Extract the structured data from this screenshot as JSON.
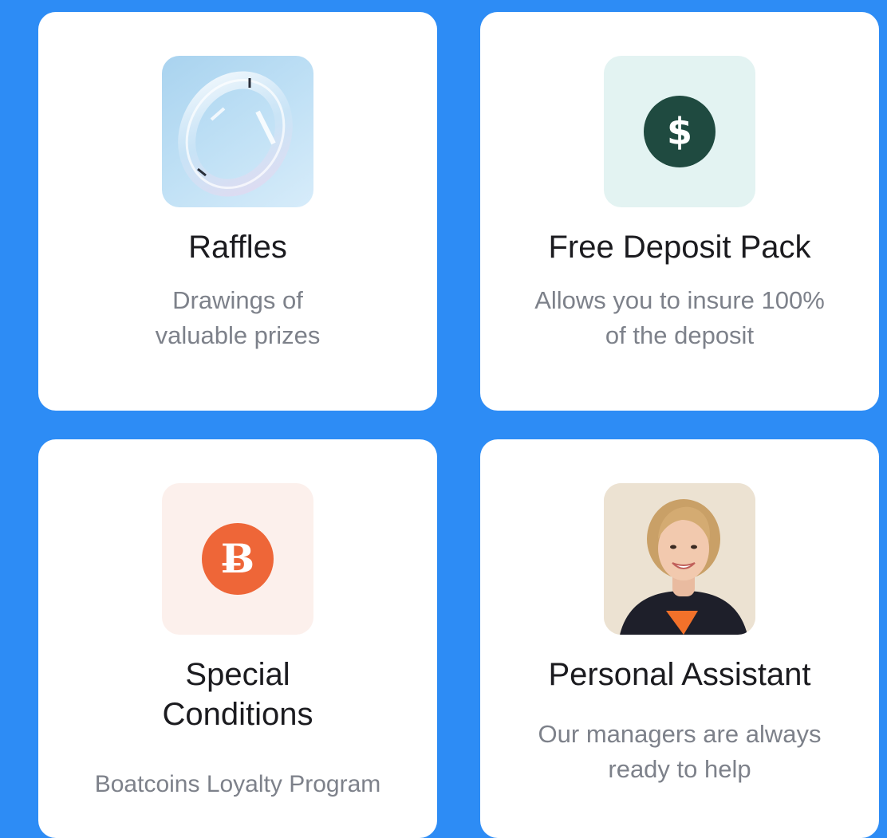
{
  "cards": [
    {
      "title": "Raffles",
      "desc_lines": [
        "Drawings of",
        "valuable prizes"
      ],
      "icon": "glass-ring-image"
    },
    {
      "title": "Free Deposit Pack",
      "desc_lines": [
        "Allows you to insure 100%",
        "of the deposit"
      ],
      "icon": "dollar-coin-icon",
      "icon_glyph": "$"
    },
    {
      "title_lines": [
        "Special",
        "Conditions"
      ],
      "desc_lines": [
        "Boatcoins Loyalty Program"
      ],
      "icon": "boatcoin-icon",
      "icon_glyph": "Ƀ"
    },
    {
      "title": "Personal Assistant",
      "desc_lines": [
        "Our managers are always",
        "ready to help"
      ],
      "icon": "assistant-avatar"
    }
  ],
  "colors": {
    "background": "#2d8cf5",
    "card": "#ffffff",
    "dollar_coin": "#1f4a40",
    "boatcoin": "#ee6638"
  }
}
